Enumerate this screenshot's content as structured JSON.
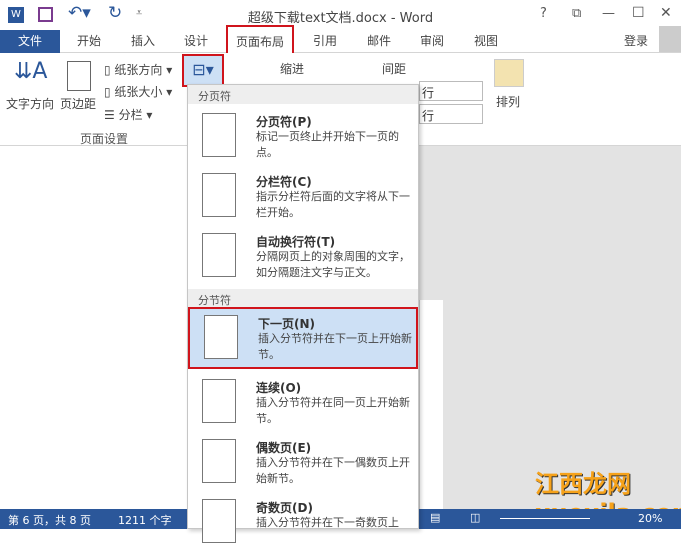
{
  "window": {
    "title": "超级下载text文档.docx - Word",
    "controls": [
      "?",
      "⧉",
      "—",
      "☐",
      "✕"
    ]
  },
  "tabs": {
    "file": "文件",
    "items": [
      "开始",
      "插入",
      "设计",
      "页面布局",
      "引用",
      "邮件",
      "审阅",
      "视图"
    ],
    "active": "页面布局",
    "login": "登录"
  },
  "ribbon": {
    "text_direction": "文字方向",
    "margins": "页边距",
    "orientation": "纸张方向",
    "size": "纸张大小",
    "columns": "分栏",
    "group_label": "页面设置",
    "indent": "缩进",
    "spacing": "间距",
    "spin1": "行",
    "spin2": "行",
    "arrange": "排列"
  },
  "menu": {
    "section1": "分页符",
    "section2": "分节符",
    "items": [
      {
        "title": "分页符(P)",
        "desc": "标记一页终止并开始下一页的点。"
      },
      {
        "title": "分栏符(C)",
        "desc": "指示分栏符后面的文字将从下一栏开始。"
      },
      {
        "title": "自动换行符(T)",
        "desc": "分隔网页上的对象周围的文字，如分隔题注文字与正文。"
      },
      {
        "title": "下一页(N)",
        "desc": "插入分节符并在下一页上开始新节。"
      },
      {
        "title": "连续(O)",
        "desc": "插入分节符并在同一页上开始新节。"
      },
      {
        "title": "偶数页(E)",
        "desc": "插入分节符并在下一偶数页上开始新节。"
      },
      {
        "title": "奇数页(D)",
        "desc": "插入分节符并在下一奇数页上"
      }
    ]
  },
  "status": {
    "page": "第 6 页，共 8 页",
    "words": "1211 个字",
    "zoom": "20%"
  },
  "watermark": "江西龙网 xuexila.com",
  "colors": {
    "accent": "#2b579a",
    "highlight": "#d0141c"
  }
}
